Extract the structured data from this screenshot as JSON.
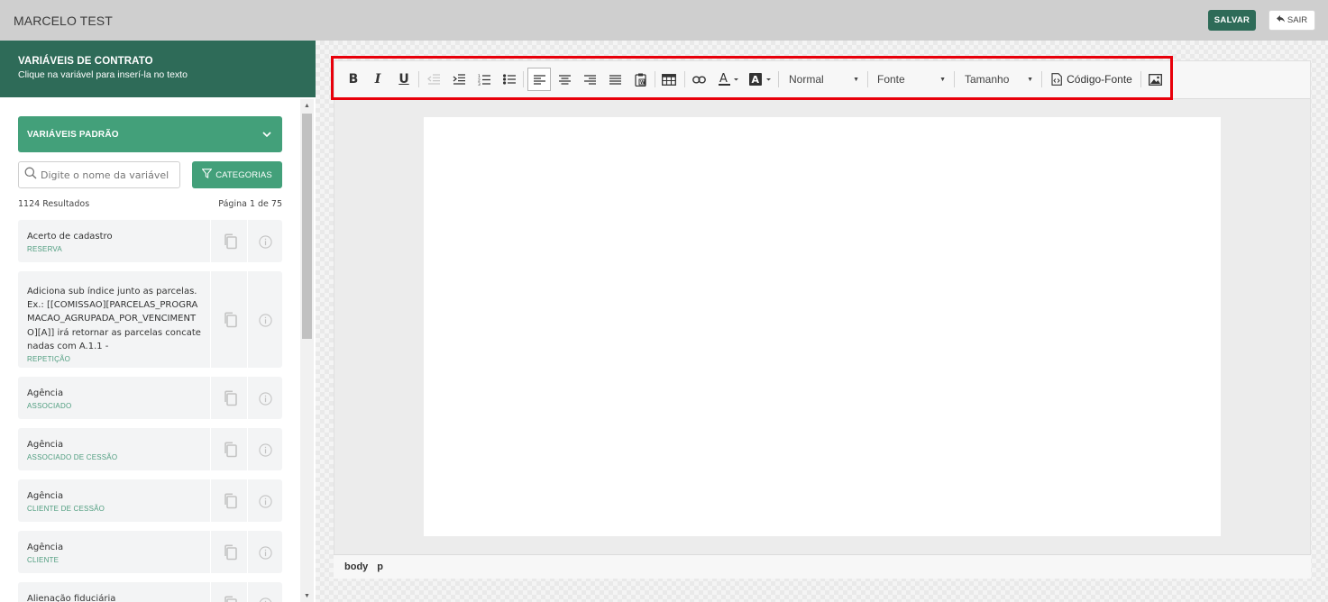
{
  "header": {
    "title": "MARCELO TEST",
    "save_label": "SALVAR",
    "exit_label": "SAIR"
  },
  "sidebar": {
    "title": "VARIÁVEIS DE CONTRATO",
    "subtitle": "Clique na variável para inserí-la no texto",
    "defaults_label": "VARIÁVEIS PADRÃO",
    "search_placeholder": "Digite o nome da variável",
    "categories_label": "CATEGORIAS",
    "result_count": "1124 Resultados",
    "page_info": "Página 1 de 75",
    "items": [
      {
        "name": "Acerto de cadastro",
        "category": "RESERVA"
      },
      {
        "name": "Adiciona sub índice junto as parcelas. Ex.: [[COMISSAO][PARCELAS_PROGRAMACAO_AGRUPADA_POR_VENCIMENTO][A]] irá retornar as parcelas concatenadas com A.1.1 -",
        "category": "REPETIÇÃO"
      },
      {
        "name": "Agência",
        "category": "ASSOCIADO"
      },
      {
        "name": "Agência",
        "category": "ASSOCIADO DE CESSÃO"
      },
      {
        "name": "Agência",
        "category": "CLIENTE DE CESSÃO"
      },
      {
        "name": "Agência",
        "category": "CLIENTE"
      },
      {
        "name": "Alienação fiduciária",
        "category": ""
      }
    ]
  },
  "toolbar": {
    "format_label": "Normal",
    "font_label": "Fonte",
    "size_label": "Tamanho",
    "source_label": "Código-Fonte"
  },
  "statusbar": {
    "path": [
      "body",
      "p"
    ]
  },
  "colors": {
    "brand_dark": "#2e6b58",
    "brand_light": "#43a07a",
    "highlight": "#e8000b"
  }
}
